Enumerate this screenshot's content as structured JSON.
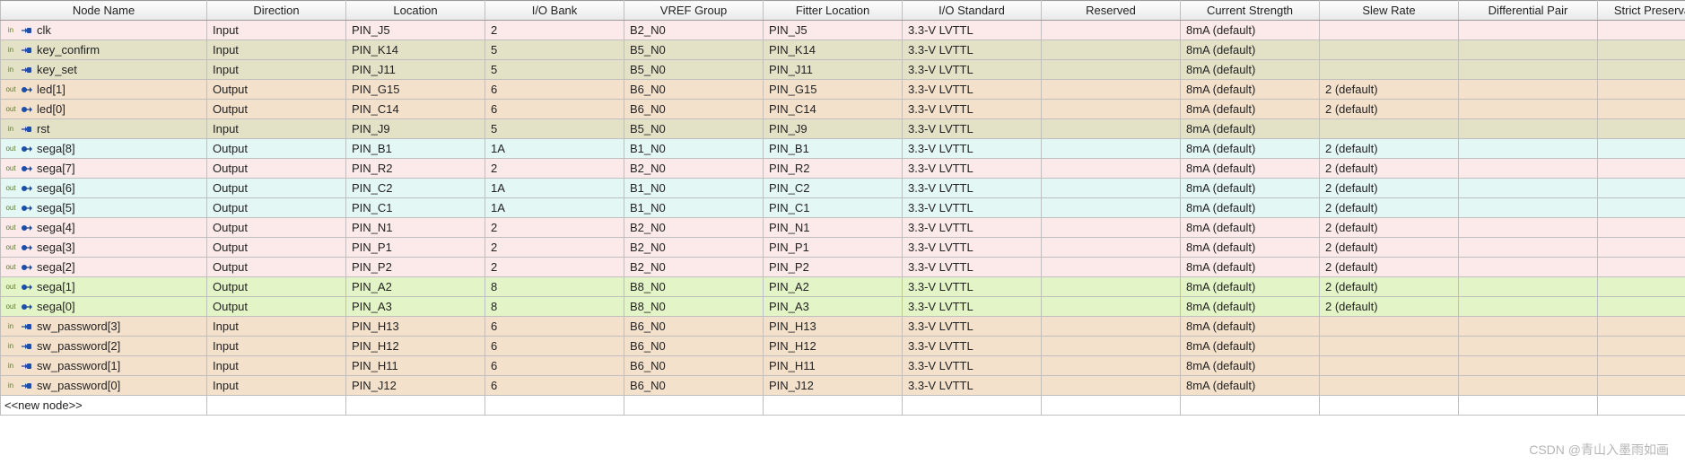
{
  "columns": [
    "Node Name",
    "Direction",
    "Location",
    "I/O Bank",
    "VREF Group",
    "Fitter Location",
    "I/O Standard",
    "Reserved",
    "Current Strength",
    "Slew Rate",
    "Differential Pair",
    "Strict Preservation"
  ],
  "rows": [
    {
      "tone": "pink",
      "icon": "in",
      "name": "clk",
      "dir": "Input",
      "loc": "PIN_J5",
      "bank": "2",
      "vref": "B2_N0",
      "fitter": "PIN_J5",
      "std": "3.3-V LVTTL",
      "res": "",
      "cur": "8mA (default)",
      "slew": "",
      "diff": "",
      "strict": ""
    },
    {
      "tone": "olive",
      "icon": "in",
      "name": "key_confirm",
      "dir": "Input",
      "loc": "PIN_K14",
      "bank": "5",
      "vref": "B5_N0",
      "fitter": "PIN_K14",
      "std": "3.3-V LVTTL",
      "res": "",
      "cur": "8mA (default)",
      "slew": "",
      "diff": "",
      "strict": ""
    },
    {
      "tone": "olive",
      "icon": "in",
      "name": "key_set",
      "dir": "Input",
      "loc": "PIN_J11",
      "bank": "5",
      "vref": "B5_N0",
      "fitter": "PIN_J11",
      "std": "3.3-V LVTTL",
      "res": "",
      "cur": "8mA (default)",
      "slew": "",
      "diff": "",
      "strict": ""
    },
    {
      "tone": "tan",
      "icon": "out",
      "name": "led[1]",
      "dir": "Output",
      "loc": "PIN_G15",
      "bank": "6",
      "vref": "B6_N0",
      "fitter": "PIN_G15",
      "std": "3.3-V LVTTL",
      "res": "",
      "cur": "8mA (default)",
      "slew": "2 (default)",
      "diff": "",
      "strict": ""
    },
    {
      "tone": "tan",
      "icon": "out",
      "name": "led[0]",
      "dir": "Output",
      "loc": "PIN_C14",
      "bank": "6",
      "vref": "B6_N0",
      "fitter": "PIN_C14",
      "std": "3.3-V LVTTL",
      "res": "",
      "cur": "8mA (default)",
      "slew": "2 (default)",
      "diff": "",
      "strict": ""
    },
    {
      "tone": "olive",
      "icon": "in",
      "name": "rst",
      "dir": "Input",
      "loc": "PIN_J9",
      "bank": "5",
      "vref": "B5_N0",
      "fitter": "PIN_J9",
      "std": "3.3-V LVTTL",
      "res": "",
      "cur": "8mA (default)",
      "slew": "",
      "diff": "",
      "strict": ""
    },
    {
      "tone": "cyan",
      "icon": "out",
      "name": "sega[8]",
      "dir": "Output",
      "loc": "PIN_B1",
      "bank": "1A",
      "vref": "B1_N0",
      "fitter": "PIN_B1",
      "std": "3.3-V LVTTL",
      "res": "",
      "cur": "8mA (default)",
      "slew": "2 (default)",
      "diff": "",
      "strict": ""
    },
    {
      "tone": "pink",
      "icon": "out",
      "name": "sega[7]",
      "dir": "Output",
      "loc": "PIN_R2",
      "bank": "2",
      "vref": "B2_N0",
      "fitter": "PIN_R2",
      "std": "3.3-V LVTTL",
      "res": "",
      "cur": "8mA (default)",
      "slew": "2 (default)",
      "diff": "",
      "strict": ""
    },
    {
      "tone": "cyan",
      "icon": "out",
      "name": "sega[6]",
      "dir": "Output",
      "loc": "PIN_C2",
      "bank": "1A",
      "vref": "B1_N0",
      "fitter": "PIN_C2",
      "std": "3.3-V LVTTL",
      "res": "",
      "cur": "8mA (default)",
      "slew": "2 (default)",
      "diff": "",
      "strict": ""
    },
    {
      "tone": "cyan",
      "icon": "out",
      "name": "sega[5]",
      "dir": "Output",
      "loc": "PIN_C1",
      "bank": "1A",
      "vref": "B1_N0",
      "fitter": "PIN_C1",
      "std": "3.3-V LVTTL",
      "res": "",
      "cur": "8mA (default)",
      "slew": "2 (default)",
      "diff": "",
      "strict": ""
    },
    {
      "tone": "pink",
      "icon": "out",
      "name": "sega[4]",
      "dir": "Output",
      "loc": "PIN_N1",
      "bank": "2",
      "vref": "B2_N0",
      "fitter": "PIN_N1",
      "std": "3.3-V LVTTL",
      "res": "",
      "cur": "8mA (default)",
      "slew": "2 (default)",
      "diff": "",
      "strict": ""
    },
    {
      "tone": "pink",
      "icon": "out",
      "name": "sega[3]",
      "dir": "Output",
      "loc": "PIN_P1",
      "bank": "2",
      "vref": "B2_N0",
      "fitter": "PIN_P1",
      "std": "3.3-V LVTTL",
      "res": "",
      "cur": "8mA (default)",
      "slew": "2 (default)",
      "diff": "",
      "strict": ""
    },
    {
      "tone": "pink",
      "icon": "out",
      "name": "sega[2]",
      "dir": "Output",
      "loc": "PIN_P2",
      "bank": "2",
      "vref": "B2_N0",
      "fitter": "PIN_P2",
      "std": "3.3-V LVTTL",
      "res": "",
      "cur": "8mA (default)",
      "slew": "2 (default)",
      "diff": "",
      "strict": ""
    },
    {
      "tone": "green",
      "icon": "out",
      "name": "sega[1]",
      "dir": "Output",
      "loc": "PIN_A2",
      "bank": "8",
      "vref": "B8_N0",
      "fitter": "PIN_A2",
      "std": "3.3-V LVTTL",
      "res": "",
      "cur": "8mA (default)",
      "slew": "2 (default)",
      "diff": "",
      "strict": ""
    },
    {
      "tone": "green",
      "icon": "out",
      "name": "sega[0]",
      "dir": "Output",
      "loc": "PIN_A3",
      "bank": "8",
      "vref": "B8_N0",
      "fitter": "PIN_A3",
      "std": "3.3-V LVTTL",
      "res": "",
      "cur": "8mA (default)",
      "slew": "2 (default)",
      "diff": "",
      "strict": ""
    },
    {
      "tone": "tan",
      "icon": "in",
      "name": "sw_password[3]",
      "dir": "Input",
      "loc": "PIN_H13",
      "bank": "6",
      "vref": "B6_N0",
      "fitter": "PIN_H13",
      "std": "3.3-V LVTTL",
      "res": "",
      "cur": "8mA (default)",
      "slew": "",
      "diff": "",
      "strict": ""
    },
    {
      "tone": "tan",
      "icon": "in",
      "name": "sw_password[2]",
      "dir": "Input",
      "loc": "PIN_H12",
      "bank": "6",
      "vref": "B6_N0",
      "fitter": "PIN_H12",
      "std": "3.3-V LVTTL",
      "res": "",
      "cur": "8mA (default)",
      "slew": "",
      "diff": "",
      "strict": ""
    },
    {
      "tone": "tan",
      "icon": "in",
      "name": "sw_password[1]",
      "dir": "Input",
      "loc": "PIN_H11",
      "bank": "6",
      "vref": "B6_N0",
      "fitter": "PIN_H11",
      "std": "3.3-V LVTTL",
      "res": "",
      "cur": "8mA (default)",
      "slew": "",
      "diff": "",
      "strict": ""
    },
    {
      "tone": "tan",
      "icon": "in",
      "name": "sw_password[0]",
      "dir": "Input",
      "loc": "PIN_J12",
      "bank": "6",
      "vref": "B6_N0",
      "fitter": "PIN_J12",
      "std": "3.3-V LVTTL",
      "res": "",
      "cur": "8mA (default)",
      "slew": "",
      "diff": "",
      "strict": ""
    }
  ],
  "new_node_placeholder": "<<new node>>",
  "watermark": "CSDN @青山入墨雨如画"
}
